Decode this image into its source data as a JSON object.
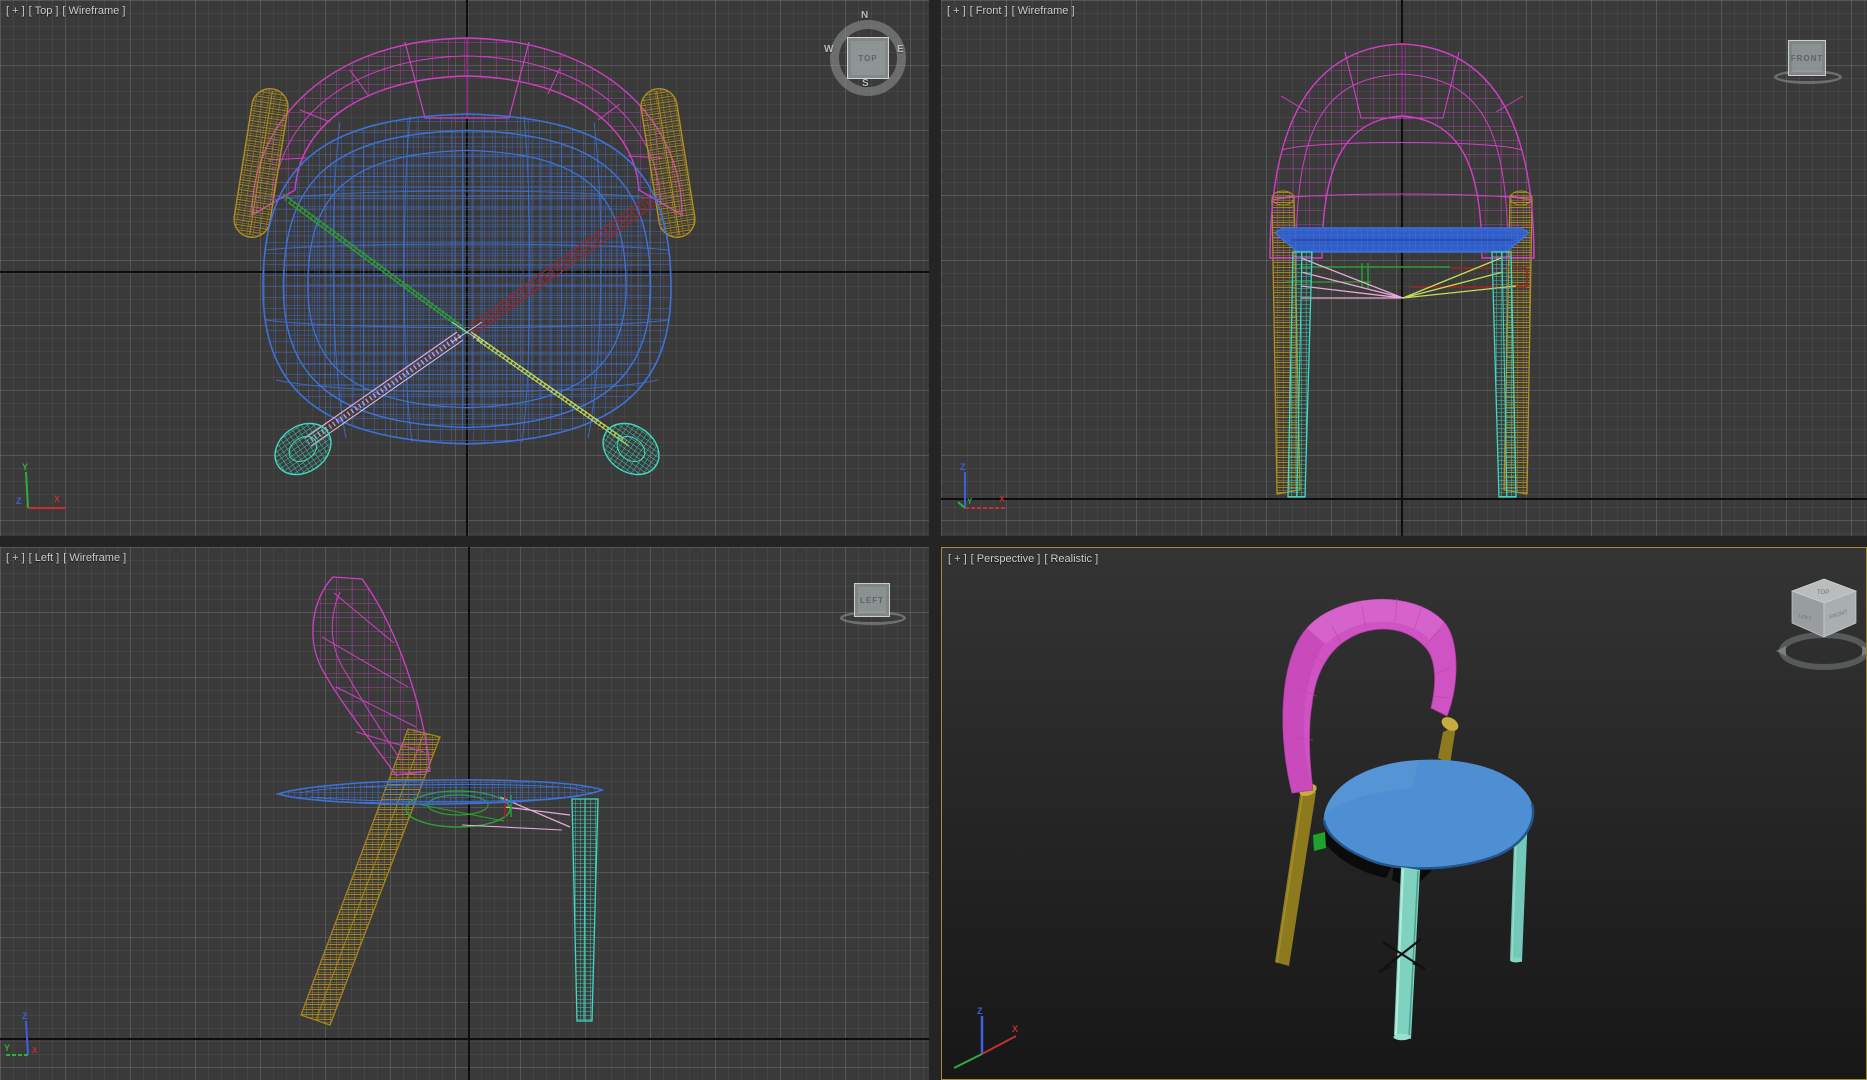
{
  "viewports": {
    "top": {
      "menu_label": "[ + ]",
      "view_label": "[ Top ]",
      "shading_label": "[ Wireframe ]",
      "viewcube": {
        "face_label": "TOP",
        "compass": {
          "north": "N",
          "east": "E",
          "south": "S",
          "west": "W"
        }
      },
      "axis_gizmo": {
        "up": "Y",
        "right": "X",
        "origin": "Z"
      }
    },
    "front": {
      "menu_label": "[ + ]",
      "view_label": "[ Front ]",
      "shading_label": "[ Wireframe ]",
      "viewcube": {
        "face_label": "FRONT"
      },
      "axis_gizmo": {
        "up": "Z",
        "right": "X",
        "origin": "Y"
      }
    },
    "left": {
      "menu_label": "[ + ]",
      "view_label": "[ Left ]",
      "shading_label": "[ Wireframe ]",
      "viewcube": {
        "face_label": "LEFT"
      },
      "axis_gizmo": {
        "up": "Z",
        "left": "Y",
        "origin": "X"
      }
    },
    "perspective": {
      "menu_label": "[ + ]",
      "view_label": "[ Perspective ]",
      "shading_label": "[ Realistic ]",
      "active": true,
      "viewcube": {
        "top_face": "TOP",
        "left_face": "LEFT",
        "front_face": "FRONT"
      },
      "axis_gizmo": {
        "up": "Z",
        "right": "X"
      }
    }
  },
  "model": {
    "object": "chair",
    "parts": [
      {
        "name": "backrest",
        "color": "#d24ac6"
      },
      {
        "name": "seat",
        "color": "#4e8ed2"
      },
      {
        "name": "rear-legs",
        "color": "#8f7b1f"
      },
      {
        "name": "front-legs",
        "color": "#7fd2c0"
      },
      {
        "name": "bracket",
        "color": "#1fa12e"
      }
    ]
  },
  "colors": {
    "viewport_background": "#3a3a3a",
    "grid_minor": "#454545",
    "grid_major": "#4f4f4f",
    "world_axis": "#0d0d0d",
    "separator": "#242424",
    "active_viewport_border": "#a08d35",
    "label_text": "#cdcdcd",
    "wire_magenta": "#d23ec6",
    "wire_blue": "#3d72d8",
    "wire_yellow": "#b08e1f",
    "wire_cyan": "#3fd9c0",
    "wire_green": "#2f9e35",
    "wire_red": "#a42222",
    "wire_pink": "#e8a8d8",
    "wire_lime": "#c6dd55"
  }
}
